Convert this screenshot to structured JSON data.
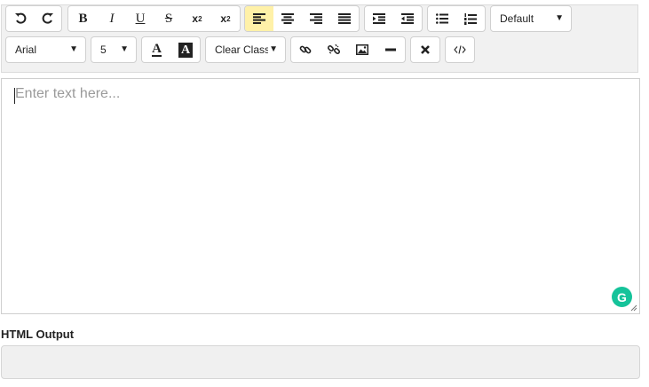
{
  "toolbar": {
    "row1": {
      "history": [
        "undo-icon",
        "redo-icon"
      ],
      "format": {
        "bold": "B",
        "italic": "I",
        "underline": "U",
        "strikethrough": "S",
        "subscript": "x",
        "sub_digit": "2",
        "superscript": "x",
        "sup_digit": "2"
      },
      "align": [
        "align-left-icon",
        "align-center-icon",
        "align-right-icon",
        "align-justify-icon"
      ],
      "active_align": "align-left",
      "indent": [
        "indent-icon",
        "outdent-icon"
      ],
      "lists": [
        "bulleted-list-icon",
        "numbered-list-icon"
      ],
      "heading_select": {
        "value": "Default"
      }
    },
    "row2": {
      "font_select": {
        "value": "Arial"
      },
      "size_select": {
        "value": "5"
      },
      "color": {
        "text_color_label": "A",
        "bg_color_label": "A"
      },
      "class_select": {
        "value": "Clear Class"
      },
      "insert": [
        "link-icon",
        "unlink-icon",
        "image-icon",
        "horizontal-rule-icon"
      ],
      "clear_format": "clear-format-icon",
      "source": "code-icon"
    },
    "active_color": "#fff1a8"
  },
  "editor": {
    "placeholder": "Enter text here...",
    "grammarly_badge": "G"
  },
  "output": {
    "label": "HTML Output",
    "value": ""
  }
}
